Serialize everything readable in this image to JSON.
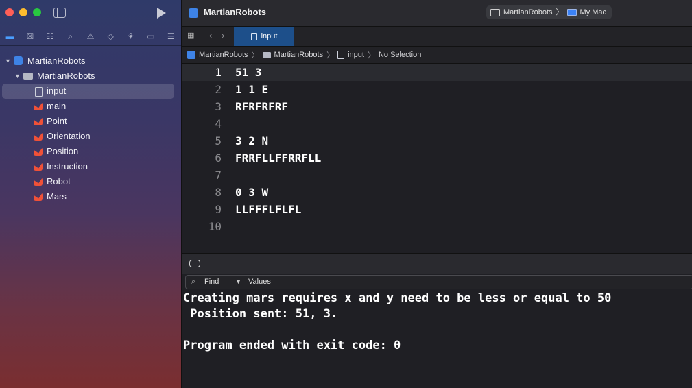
{
  "toolbar": {
    "title": "MartianRobots",
    "scheme": {
      "target": "MartianRobots",
      "device": "My Mac"
    }
  },
  "navigator": {
    "icons": [
      "folder-icon",
      "source-control-icon",
      "hierarchy-icon",
      "search-icon",
      "warning-icon",
      "test-icon",
      "debug-icon",
      "breakpoint-icon",
      "report-icon"
    ],
    "project": "MartianRobots",
    "group": "MartianRobots",
    "files": [
      "input",
      "main",
      "Point",
      "Orientation",
      "Position",
      "Instruction",
      "Robot",
      "Mars"
    ],
    "selected_file": "input"
  },
  "tabs": [
    {
      "label": "input"
    }
  ],
  "jumpbar": {
    "project": "MartianRobots",
    "group": "MartianRobots",
    "file": "input",
    "selection": "No Selection"
  },
  "editor": {
    "current_line": 1,
    "lines": [
      "51 3",
      "1 1 E",
      "RFRFRFRF",
      "",
      "3 2 N",
      "FRRFLLFFRRFLL",
      "",
      "0 3 W",
      "LLFFFLFLFL",
      ""
    ]
  },
  "find": {
    "label": "Find",
    "scope": "Values"
  },
  "console": {
    "lines": [
      "Creating mars requires x and y need to be less or equal to 50",
      " Position sent: 51, 3.",
      "",
      "Program ended with exit code: 0"
    ]
  }
}
